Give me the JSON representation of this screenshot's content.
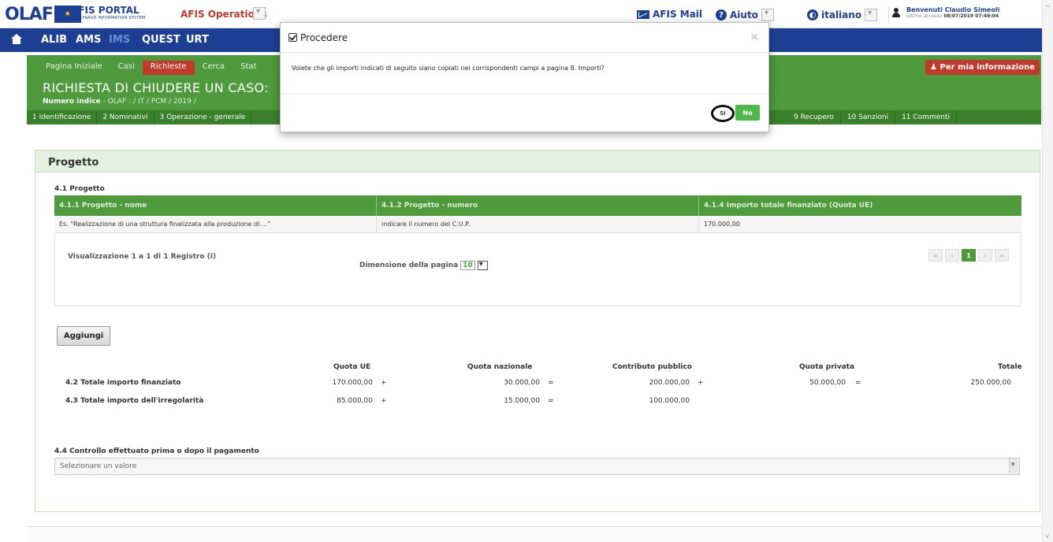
{
  "header": {
    "logo_text": "OLAF",
    "portal_title": "AFIS PORTAL",
    "portal_subtitle": "ANTI-FRAUD INFORMATION SYSTEM",
    "operations": "AFIS Operations",
    "mail": "AFIS Mail",
    "help": "Aiuto",
    "language": "italiano",
    "user_welcome": "Benvenuti Claudio Simeoli",
    "last_access_label": "Ultimo accesso",
    "last_access_value": "08/07/2019 07:48:04"
  },
  "nav": {
    "items": [
      "ALIB",
      "AMS",
      "IMS",
      "QUEST",
      "URT"
    ],
    "active": "IMS"
  },
  "subnav": {
    "items": [
      "Pagina Iniziale",
      "Casi",
      "Richieste",
      "Cerca",
      "Stat"
    ]
  },
  "case": {
    "title": "RICHIESTA DI CHIUDERE UN CASO:",
    "index_label": "Numero indice",
    "index_value": "- OLAF : / IT / PCM / 2019 /",
    "info_button": "Per mia informazione"
  },
  "tabs": {
    "left": [
      "1 Identificazione",
      "2 Nominativi",
      "3 Operazione - generale"
    ],
    "right": [
      "9 Recupero",
      "10 Sanzioni",
      "11 Commenti"
    ]
  },
  "panel": {
    "title": "Progetto",
    "section_41": "4.1 Progetto",
    "columns": [
      "4.1.1 Progetto - nome",
      "4.1.2 Progetto - numero",
      "4.1.4 Importo totale finanziato (Quota UE)"
    ],
    "rows": [
      [
        "Es. \"Realizzazione di una struttura finalizzata alla produzione di....\"",
        "indicare il numero del C.U.P.",
        "170.000,00"
      ]
    ],
    "record_count": "Visualizzazione 1 a 1 di 1 Registro (i)",
    "page_size_label": "Dimensione della pagina",
    "page_size_value": "10",
    "pager": [
      "«",
      "‹",
      "1",
      "›",
      "»"
    ],
    "add_button": "Aggiungi"
  },
  "totals": {
    "headers": [
      "Quota UE",
      "Quota nazionale",
      "Contributo pubblico",
      "Quota privata",
      "Totale"
    ],
    "row1_label": "4.2 Totale importo finanziato",
    "row1": [
      "170.000,00",
      "+",
      "30.000,00",
      "=",
      "200.000,00",
      "+",
      "50.000,00",
      "=",
      "250.000,00"
    ],
    "row2_label": "4.3 Totale importo dell'irregolarità",
    "row2": [
      "85.000,00",
      "+",
      "15.000,00",
      "=",
      "100.000,00"
    ]
  },
  "control": {
    "label": "4.4 Controllo effettuato prima o dopo il pagamento",
    "placeholder": "Selezionare un valore"
  },
  "modal": {
    "title": "Procedere",
    "close": "×",
    "message": "Volete che gli importi indicati di seguito siano copiati nei corrispondenti campi a pagina 8. Importi?",
    "yes": "Si",
    "no": "No"
  }
}
